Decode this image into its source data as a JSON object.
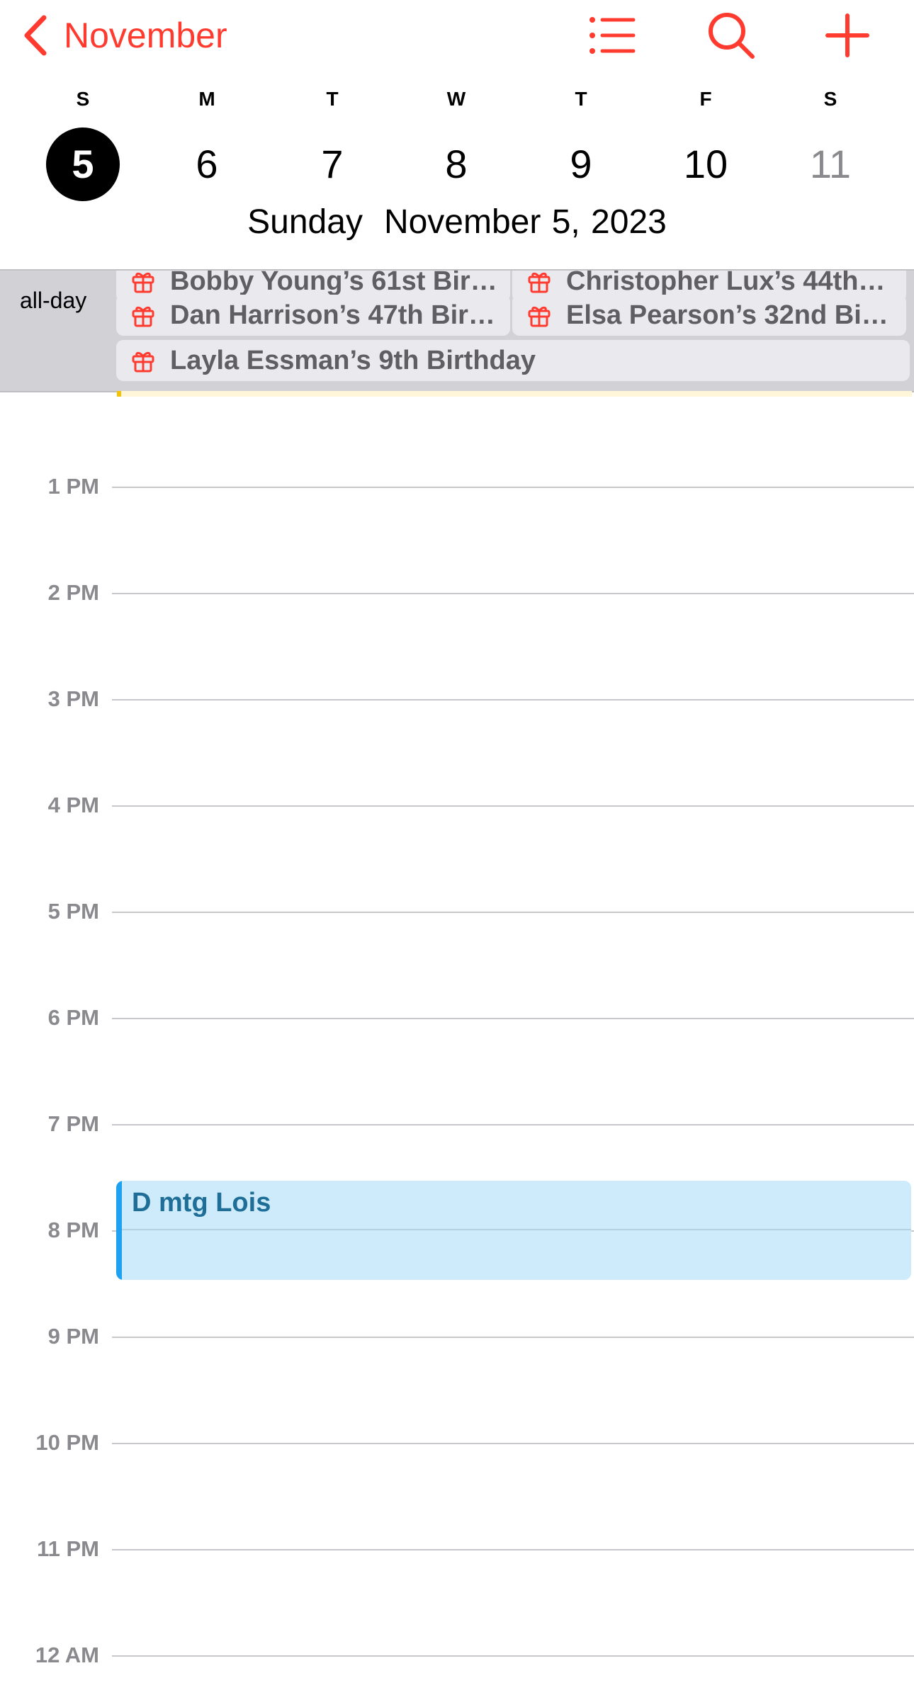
{
  "nav": {
    "back_label": "November",
    "icons": [
      "chevron-left-icon",
      "list-icon",
      "search-icon",
      "plus-icon"
    ],
    "accent_color": "#FF3B30"
  },
  "week": {
    "days": [
      {
        "dow": "S",
        "num": "5",
        "selected": true
      },
      {
        "dow": "M",
        "num": "6"
      },
      {
        "dow": "T",
        "num": "7"
      },
      {
        "dow": "W",
        "num": "8"
      },
      {
        "dow": "T",
        "num": "9"
      },
      {
        "dow": "F",
        "num": "10"
      },
      {
        "dow": "S",
        "num": "11",
        "dim": true
      }
    ]
  },
  "date_title": {
    "weekday": "Sunday",
    "date": "November 5, 2023"
  },
  "allday": {
    "label": "all-day",
    "events": [
      "Bobby Young’s 61st Bir…",
      "Christopher Lux’s 44th…",
      "Dan Harrison’s 47th Bir…",
      "Elsa Pearson’s 32nd Bir…",
      "Layla Essman’s 9th Birthday"
    ]
  },
  "timeline": {
    "hours": [
      "1 PM",
      "2 PM",
      "3 PM",
      "4 PM",
      "5 PM",
      "6 PM",
      "7 PM",
      "8 PM",
      "9 PM",
      "10 PM",
      "11 PM",
      "12 AM"
    ]
  },
  "event": {
    "title": "D mtg Lois",
    "color": "#1EA1F1"
  }
}
